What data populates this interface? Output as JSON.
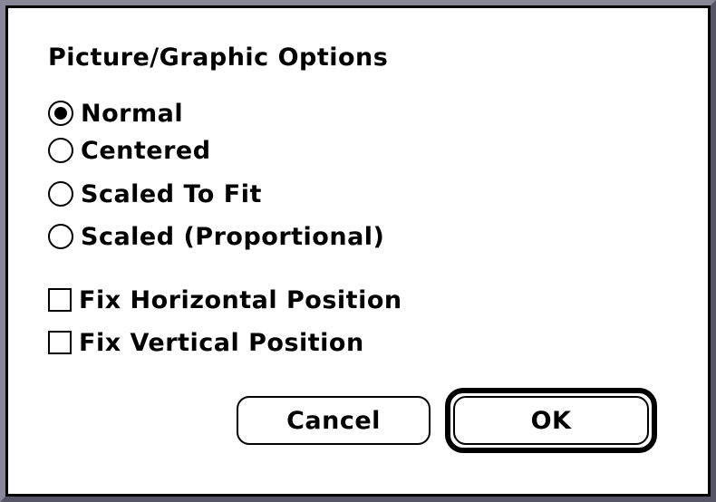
{
  "dialog": {
    "title": "Picture/Graphic Options",
    "radio_options": [
      {
        "label": "Normal",
        "checked": true
      },
      {
        "label": "Centered",
        "checked": false
      },
      {
        "label": "Scaled To Fit",
        "checked": false
      },
      {
        "label": "Scaled (Proportional)",
        "checked": false
      }
    ],
    "checkbox_options": [
      {
        "label": "Fix Horizontal Position",
        "checked": false
      },
      {
        "label": "Fix Vertical Position",
        "checked": false
      }
    ],
    "buttons": {
      "cancel_label": "Cancel",
      "ok_label": "OK",
      "default_button": "OK"
    }
  },
  "colors": {
    "background": "#ffffff",
    "foreground": "#000000",
    "frame_light": "#888899",
    "frame_dark": "#555566"
  }
}
